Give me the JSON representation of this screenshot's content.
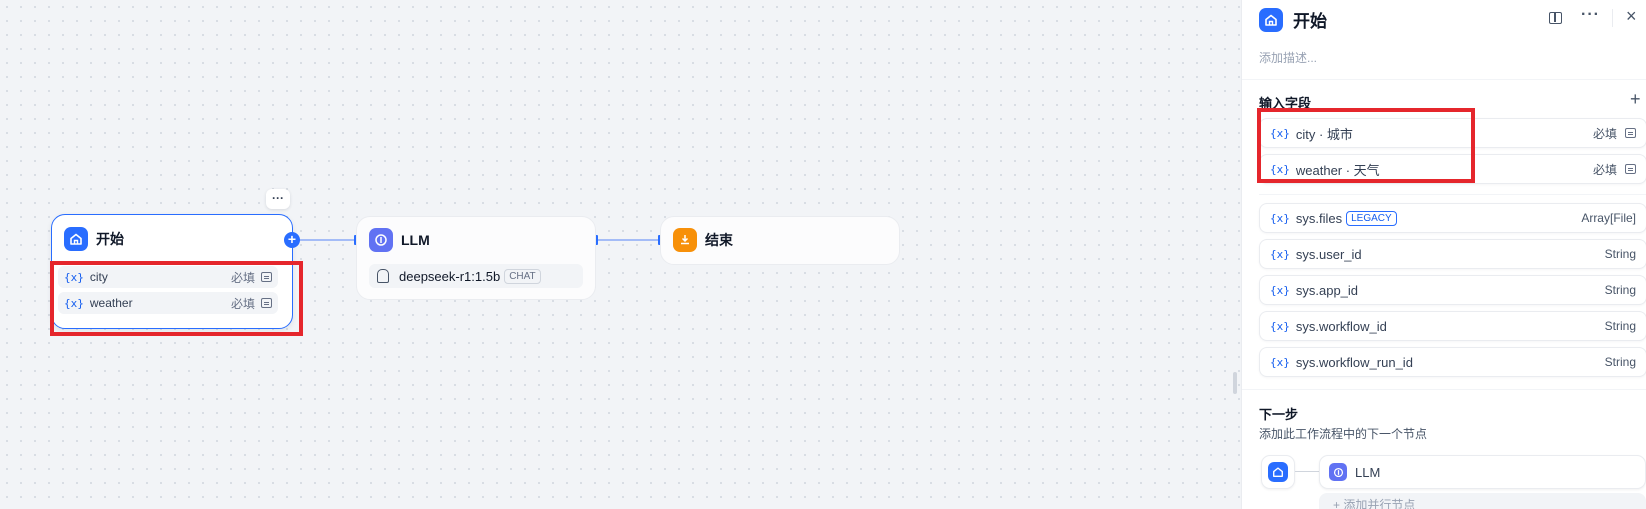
{
  "canvas": {
    "start_node": {
      "title": "开始",
      "more_label": "···",
      "variables": [
        {
          "name": "city",
          "required": "必填"
        },
        {
          "name": "weather",
          "required": "必填"
        }
      ]
    },
    "llm_node": {
      "title": "LLM",
      "model": "deepseek-r1:1.5b",
      "mode": "CHAT"
    },
    "end_node": {
      "title": "结束"
    },
    "var_prefix": "{x}"
  },
  "panel": {
    "title": "开始",
    "description_placeholder": "添加描述...",
    "input_section_label": "输入字段",
    "input_fields": [
      {
        "label": "city · 城市",
        "required": "必填"
      },
      {
        "label": "weather · 天气",
        "required": "必填"
      }
    ],
    "system_vars": [
      {
        "name": "sys.files",
        "badge": "LEGACY",
        "type": "Array[File]"
      },
      {
        "name": "sys.user_id",
        "type": "String"
      },
      {
        "name": "sys.app_id",
        "type": "String"
      },
      {
        "name": "sys.workflow_id",
        "type": "String"
      },
      {
        "name": "sys.workflow_run_id",
        "type": "String"
      }
    ],
    "next_step": {
      "title": "下一步",
      "subtitle": "添加此工作流程中的下一个节点",
      "next_node_label": "LLM",
      "add_parallel_label": "+ 添加并行节点"
    }
  },
  "colors": {
    "accent": "#296dff",
    "highlight_red": "#e5262c",
    "llm_purple": "#6172f3",
    "end_orange": "#f79009"
  }
}
